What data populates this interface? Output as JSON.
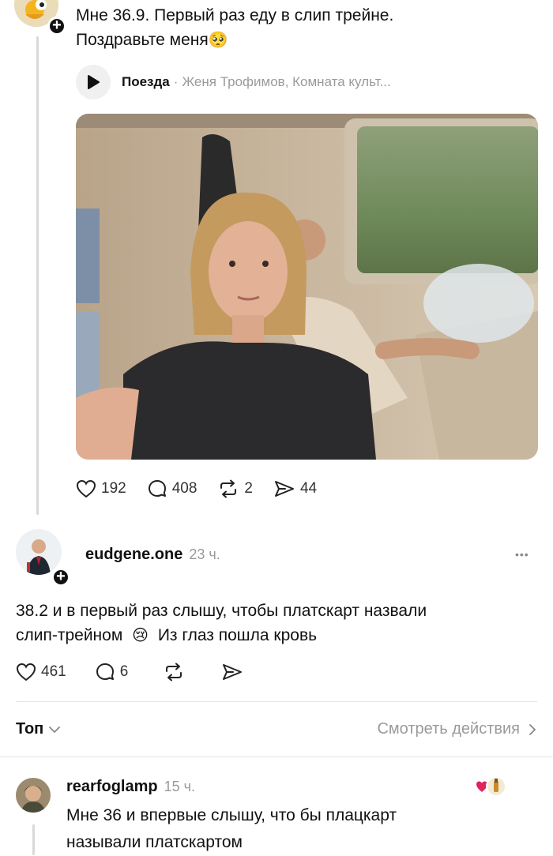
{
  "post1": {
    "text_line1": "Мне 36.9. Первый раз еду в слип трейне.",
    "text_line2": "Поздравьте меня",
    "emoji": "🥺",
    "music": {
      "title": "Поезда",
      "separator": "·",
      "artists": "Женя Трофимов, Комната культ..."
    },
    "stats": {
      "likes": "192",
      "comments": "408",
      "reposts": "2",
      "shares": "44"
    }
  },
  "post2": {
    "username": "eudgene.one",
    "time": "23 ч.",
    "more": "•••",
    "text_line1": "38.2 и в первый раз слышу, чтобы платскарт назвали",
    "text_line2_a": "слип-трейном",
    "emoji": "😢",
    "text_line2_b": "Из глаз пошла кровь",
    "stats": {
      "likes": "461",
      "comments": "6"
    }
  },
  "sort_bar": {
    "label": "Топ",
    "view_activity": "Смотреть действия"
  },
  "reply": {
    "username": "rearfoglamp",
    "time": "15 ч.",
    "text_line1": "Мне 36 и впервые слышу, что бы плацкарт",
    "text_line2": "называли платскартом"
  },
  "colors": {
    "text": "#111111",
    "muted": "#9a9a9a",
    "divider": "#e6e6e6",
    "heart": "#e0245e"
  }
}
